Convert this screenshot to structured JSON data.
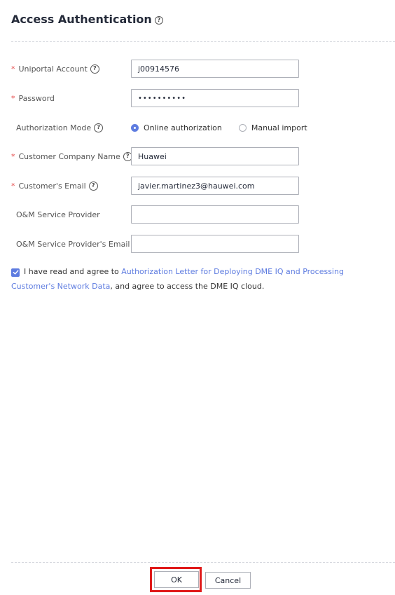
{
  "dialog": {
    "title": "Access Authentication"
  },
  "form": {
    "uniportal_account": {
      "label": "Uniportal Account",
      "value": "j00914576"
    },
    "password": {
      "label": "Password",
      "value": "••••••••••"
    },
    "authorization_mode": {
      "label": "Authorization Mode",
      "options": [
        {
          "label": "Online authorization",
          "selected": true
        },
        {
          "label": "Manual import",
          "selected": false
        }
      ]
    },
    "customer_company_name": {
      "label": "Customer Company Name",
      "value": "Huawei"
    },
    "customer_email": {
      "label": "Customer's Email",
      "value": "javier.martinez3@hauwei.com"
    },
    "om_service_provider": {
      "label": "O&M Service Provider",
      "value": ""
    },
    "om_service_provider_email": {
      "label": "O&M Service Provider's Email",
      "value": ""
    }
  },
  "agreement": {
    "checked": true,
    "prefix": "I have read and agree to ",
    "link_text": "Authorization Letter for Deploying DME IQ and Processing Customer's Network Data",
    "suffix": ", and agree to access the DME IQ cloud."
  },
  "footer": {
    "ok_label": "OK",
    "cancel_label": "Cancel"
  },
  "colors": {
    "accent": "#5e7ce0",
    "required": "#e54545",
    "highlight": "#e01a1a"
  }
}
